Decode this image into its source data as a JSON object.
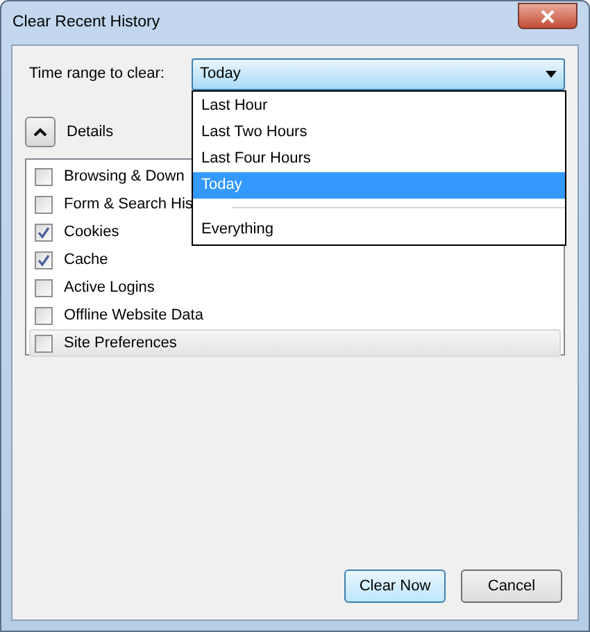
{
  "window": {
    "title": "Clear Recent History"
  },
  "time_range": {
    "label": "Time range to clear:",
    "value": "Today",
    "expanded": true,
    "options": [
      {
        "label": "Last Hour",
        "selected": false
      },
      {
        "label": "Last Two Hours",
        "selected": false
      },
      {
        "label": "Last Four Hours",
        "selected": false
      },
      {
        "label": "Today",
        "selected": true
      },
      {
        "label": "Everything",
        "selected": false,
        "separator_before": true
      }
    ]
  },
  "details": {
    "label": "Details",
    "expanded": true
  },
  "items": [
    {
      "label": "Browsing & Down",
      "checked": false,
      "focused": false
    },
    {
      "label": "Form & Search His",
      "checked": false,
      "focused": false
    },
    {
      "label": "Cookies",
      "checked": true,
      "focused": false
    },
    {
      "label": "Cache",
      "checked": true,
      "focused": false
    },
    {
      "label": "Active Logins",
      "checked": false,
      "focused": false
    },
    {
      "label": "Offline Website Data",
      "checked": false,
      "focused": false
    },
    {
      "label": "Site Preferences",
      "checked": false,
      "focused": true
    }
  ],
  "buttons": [
    {
      "label": "Clear Now",
      "default": true
    },
    {
      "label": "Cancel",
      "default": false
    }
  ]
}
